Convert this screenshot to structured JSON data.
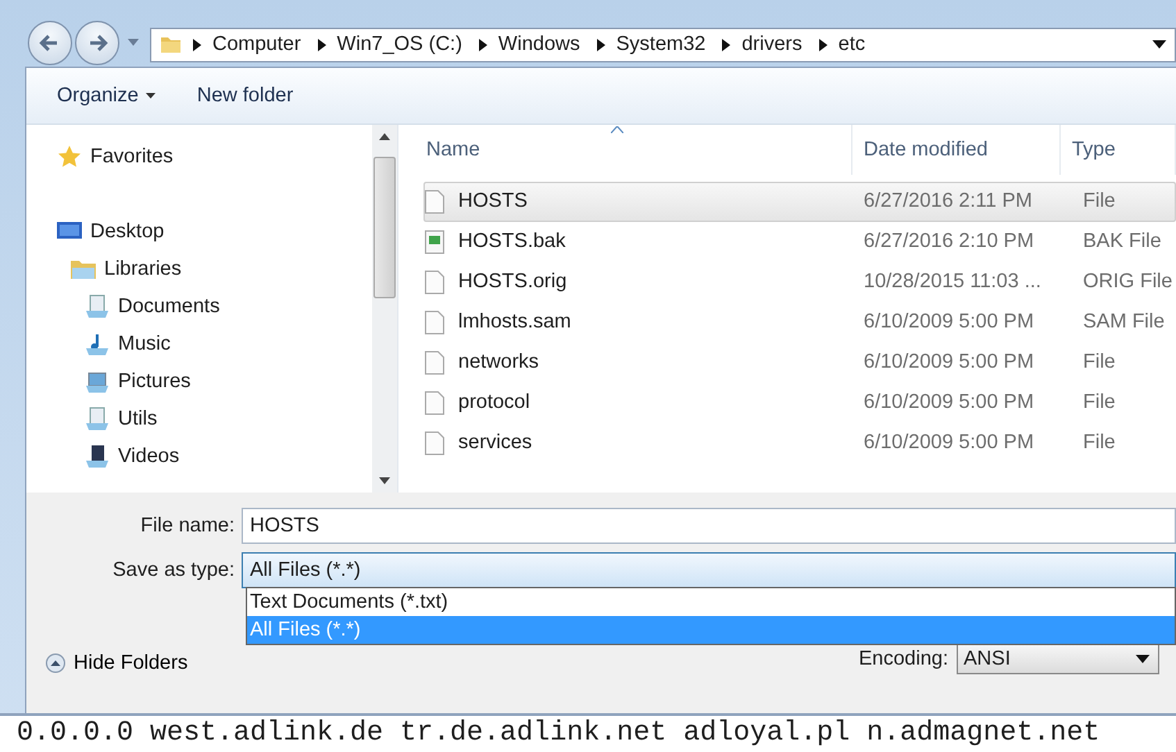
{
  "address_bar": {
    "segments": [
      "Computer",
      "Win7_OS (C:)",
      "Windows",
      "System32",
      "drivers",
      "etc"
    ]
  },
  "toolbar": {
    "organize": "Organize",
    "new_folder": "New folder"
  },
  "nav_tree": [
    {
      "label": "Favorites",
      "kind": "favorites"
    },
    {
      "label": "Desktop",
      "kind": "desktop",
      "children": [
        {
          "label": "Libraries",
          "kind": "libraries",
          "children": [
            {
              "label": "Documents",
              "kind": "documents"
            },
            {
              "label": "Music",
              "kind": "music"
            },
            {
              "label": "Pictures",
              "kind": "pictures"
            },
            {
              "label": "Utils",
              "kind": "documents"
            },
            {
              "label": "Videos",
              "kind": "videos"
            }
          ]
        }
      ]
    }
  ],
  "file_list": {
    "columns": [
      "Name",
      "Date modified",
      "Type"
    ],
    "rows": [
      {
        "name": "HOSTS",
        "date": "6/27/2016 2:11 PM",
        "type": "File",
        "kind": "blank",
        "selected": true
      },
      {
        "name": "HOSTS.bak",
        "date": "6/27/2016 2:10 PM",
        "type": "BAK File",
        "kind": "bak",
        "selected": false
      },
      {
        "name": "HOSTS.orig",
        "date": "10/28/2015 11:03 ...",
        "type": "ORIG File",
        "kind": "blank",
        "selected": false
      },
      {
        "name": "lmhosts.sam",
        "date": "6/10/2009 5:00 PM",
        "type": "SAM File",
        "kind": "blank",
        "selected": false
      },
      {
        "name": "networks",
        "date": "6/10/2009 5:00 PM",
        "type": "File",
        "kind": "blank",
        "selected": false
      },
      {
        "name": "protocol",
        "date": "6/10/2009 5:00 PM",
        "type": "File",
        "kind": "blank",
        "selected": false
      },
      {
        "name": "services",
        "date": "6/10/2009 5:00 PM",
        "type": "File",
        "kind": "blank",
        "selected": false
      }
    ]
  },
  "file_name": {
    "label": "File name:",
    "value": "HOSTS"
  },
  "save_as_type": {
    "label": "Save as type:",
    "value": "All Files  (*.*)",
    "options": [
      {
        "label": "Text Documents (*.txt)",
        "selected": false
      },
      {
        "label": "All Files  (*.*)",
        "selected": true
      }
    ]
  },
  "hide_folders": "Hide Folders",
  "encoding": {
    "label": "Encoding:",
    "value": "ANSI"
  },
  "background_text": "0.0.0.0 west.adlink.de tr.de.adlink.net adloyal.pl n.admagnet.net"
}
